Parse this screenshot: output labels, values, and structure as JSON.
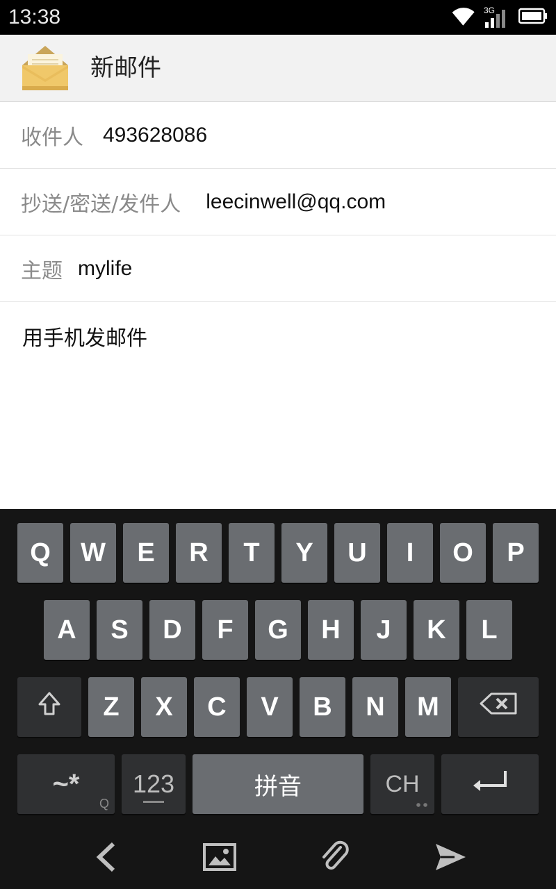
{
  "status_bar": {
    "time": "13:38",
    "network": "3G"
  },
  "header": {
    "title": "新邮件",
    "icon": "envelope-icon"
  },
  "form": {
    "to_label": "收件人",
    "to_value": "493628086",
    "cc_label": "抄送/密送/发件人",
    "cc_value": "leecinwell@qq.com",
    "subject_label": "主题",
    "subject_value": "mylife",
    "body": "用手机发邮件"
  },
  "keyboard": {
    "row1": [
      "Q",
      "W",
      "E",
      "R",
      "T",
      "Y",
      "U",
      "I",
      "O",
      "P"
    ],
    "row2": [
      "A",
      "S",
      "D",
      "F",
      "G",
      "H",
      "J",
      "K",
      "L"
    ],
    "row3": [
      "Z",
      "X",
      "C",
      "V",
      "B",
      "N",
      "M"
    ],
    "symbols_label": "~*",
    "symbols_sub": "Q",
    "numbers_label": "123",
    "space_label": "拼音",
    "lang_label": "CH"
  },
  "colors": {
    "key": "#6a6d71",
    "key_dark": "#2f3032",
    "keyboard_bg": "#151515",
    "title_bar": "#f2f2f2"
  }
}
